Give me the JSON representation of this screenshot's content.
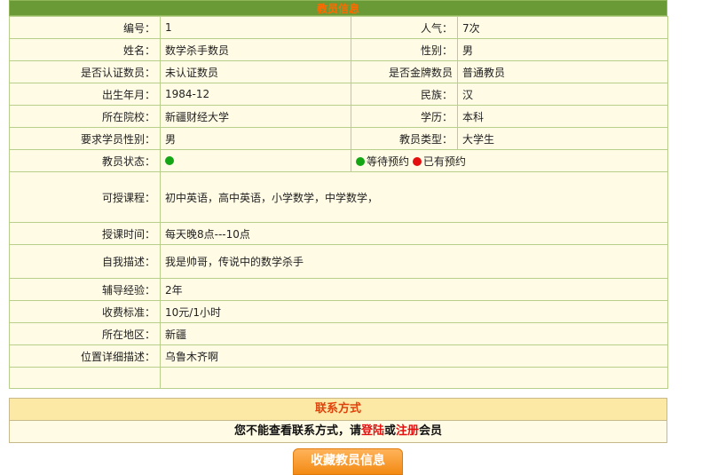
{
  "header": {
    "title": "教员信息"
  },
  "colors": {
    "header_bg": "#6a9a35",
    "header_text": "#ff6a00",
    "row_bg": "#fffbe5",
    "border": "#b7cf8a",
    "link": "#e41010"
  },
  "rows": {
    "id": {
      "label": "编号：",
      "value": "1"
    },
    "popularity": {
      "label": "人气：",
      "value": "7次"
    },
    "name": {
      "label": "姓名：",
      "value": "数学杀手数员"
    },
    "gender": {
      "label": "性别：",
      "value": "男"
    },
    "certified": {
      "label": "是否认证数员：",
      "value": "未认证数员"
    },
    "gold": {
      "label": "是否金牌数员",
      "value": "普通教员"
    },
    "birth": {
      "label": "出生年月：",
      "value": "1984-12"
    },
    "ethnicity": {
      "label": "民族：",
      "value": "汉"
    },
    "school": {
      "label": "所在院校：",
      "value": "新疆财经大学"
    },
    "education": {
      "label": "学历：",
      "value": "本科"
    },
    "student_gender": {
      "label": "要求学员性别：",
      "value": "男"
    },
    "tutor_type": {
      "label": "教员类型：",
      "value": "大学生"
    },
    "status": {
      "label": "教员状态：",
      "legend_waiting": "等待预约",
      "legend_booked": "已有预约"
    },
    "courses": {
      "label": "可授课程：",
      "value": "初中英语，高中英语，小学数学，中学数学，"
    },
    "time": {
      "label": "授课时间：",
      "value": "每天晚8点---10点"
    },
    "self_desc": {
      "label": "自我描述：",
      "value": "我是帅哥，传说中的数学杀手"
    },
    "experience": {
      "label": "辅导经验：",
      "value": "2年"
    },
    "fee": {
      "label": "收费标准：",
      "value": "10元/1小时"
    },
    "region": {
      "label": "所在地区：",
      "value": "新疆"
    },
    "address": {
      "label": "位置详细描述：",
      "value": "乌鲁木齐啊"
    }
  },
  "contact": {
    "title": "联系方式",
    "text_before": "您不能查看联系方式，请",
    "login_link": "登陆",
    "or_text": "或",
    "register_link": "注册",
    "text_after": "会员"
  },
  "favorite_button": {
    "label": "收藏教员信息"
  }
}
